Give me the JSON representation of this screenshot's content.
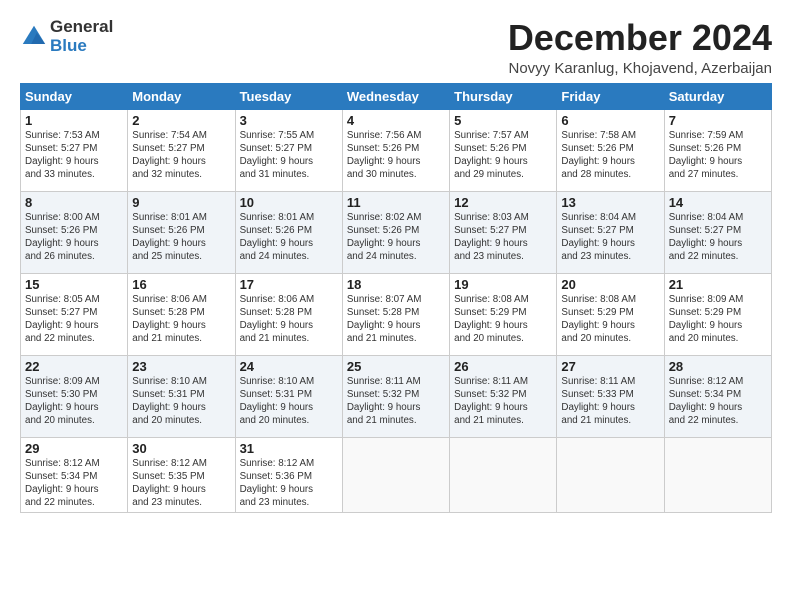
{
  "logo": {
    "general": "General",
    "blue": "Blue"
  },
  "title": "December 2024",
  "location": "Novyy Karanlug, Khojavend, Azerbaijan",
  "weekdays": [
    "Sunday",
    "Monday",
    "Tuesday",
    "Wednesday",
    "Thursday",
    "Friday",
    "Saturday"
  ],
  "weeks": [
    [
      {
        "day": "1",
        "info": "Sunrise: 7:53 AM\nSunset: 5:27 PM\nDaylight: 9 hours\nand 33 minutes."
      },
      {
        "day": "2",
        "info": "Sunrise: 7:54 AM\nSunset: 5:27 PM\nDaylight: 9 hours\nand 32 minutes."
      },
      {
        "day": "3",
        "info": "Sunrise: 7:55 AM\nSunset: 5:27 PM\nDaylight: 9 hours\nand 31 minutes."
      },
      {
        "day": "4",
        "info": "Sunrise: 7:56 AM\nSunset: 5:26 PM\nDaylight: 9 hours\nand 30 minutes."
      },
      {
        "day": "5",
        "info": "Sunrise: 7:57 AM\nSunset: 5:26 PM\nDaylight: 9 hours\nand 29 minutes."
      },
      {
        "day": "6",
        "info": "Sunrise: 7:58 AM\nSunset: 5:26 PM\nDaylight: 9 hours\nand 28 minutes."
      },
      {
        "day": "7",
        "info": "Sunrise: 7:59 AM\nSunset: 5:26 PM\nDaylight: 9 hours\nand 27 minutes."
      }
    ],
    [
      {
        "day": "8",
        "info": "Sunrise: 8:00 AM\nSunset: 5:26 PM\nDaylight: 9 hours\nand 26 minutes."
      },
      {
        "day": "9",
        "info": "Sunrise: 8:01 AM\nSunset: 5:26 PM\nDaylight: 9 hours\nand 25 minutes."
      },
      {
        "day": "10",
        "info": "Sunrise: 8:01 AM\nSunset: 5:26 PM\nDaylight: 9 hours\nand 24 minutes."
      },
      {
        "day": "11",
        "info": "Sunrise: 8:02 AM\nSunset: 5:26 PM\nDaylight: 9 hours\nand 24 minutes."
      },
      {
        "day": "12",
        "info": "Sunrise: 8:03 AM\nSunset: 5:27 PM\nDaylight: 9 hours\nand 23 minutes."
      },
      {
        "day": "13",
        "info": "Sunrise: 8:04 AM\nSunset: 5:27 PM\nDaylight: 9 hours\nand 23 minutes."
      },
      {
        "day": "14",
        "info": "Sunrise: 8:04 AM\nSunset: 5:27 PM\nDaylight: 9 hours\nand 22 minutes."
      }
    ],
    [
      {
        "day": "15",
        "info": "Sunrise: 8:05 AM\nSunset: 5:27 PM\nDaylight: 9 hours\nand 22 minutes."
      },
      {
        "day": "16",
        "info": "Sunrise: 8:06 AM\nSunset: 5:28 PM\nDaylight: 9 hours\nand 21 minutes."
      },
      {
        "day": "17",
        "info": "Sunrise: 8:06 AM\nSunset: 5:28 PM\nDaylight: 9 hours\nand 21 minutes."
      },
      {
        "day": "18",
        "info": "Sunrise: 8:07 AM\nSunset: 5:28 PM\nDaylight: 9 hours\nand 21 minutes."
      },
      {
        "day": "19",
        "info": "Sunrise: 8:08 AM\nSunset: 5:29 PM\nDaylight: 9 hours\nand 20 minutes."
      },
      {
        "day": "20",
        "info": "Sunrise: 8:08 AM\nSunset: 5:29 PM\nDaylight: 9 hours\nand 20 minutes."
      },
      {
        "day": "21",
        "info": "Sunrise: 8:09 AM\nSunset: 5:29 PM\nDaylight: 9 hours\nand 20 minutes."
      }
    ],
    [
      {
        "day": "22",
        "info": "Sunrise: 8:09 AM\nSunset: 5:30 PM\nDaylight: 9 hours\nand 20 minutes."
      },
      {
        "day": "23",
        "info": "Sunrise: 8:10 AM\nSunset: 5:31 PM\nDaylight: 9 hours\nand 20 minutes."
      },
      {
        "day": "24",
        "info": "Sunrise: 8:10 AM\nSunset: 5:31 PM\nDaylight: 9 hours\nand 20 minutes."
      },
      {
        "day": "25",
        "info": "Sunrise: 8:11 AM\nSunset: 5:32 PM\nDaylight: 9 hours\nand 21 minutes."
      },
      {
        "day": "26",
        "info": "Sunrise: 8:11 AM\nSunset: 5:32 PM\nDaylight: 9 hours\nand 21 minutes."
      },
      {
        "day": "27",
        "info": "Sunrise: 8:11 AM\nSunset: 5:33 PM\nDaylight: 9 hours\nand 21 minutes."
      },
      {
        "day": "28",
        "info": "Sunrise: 8:12 AM\nSunset: 5:34 PM\nDaylight: 9 hours\nand 22 minutes."
      }
    ],
    [
      {
        "day": "29",
        "info": "Sunrise: 8:12 AM\nSunset: 5:34 PM\nDaylight: 9 hours\nand 22 minutes."
      },
      {
        "day": "30",
        "info": "Sunrise: 8:12 AM\nSunset: 5:35 PM\nDaylight: 9 hours\nand 23 minutes."
      },
      {
        "day": "31",
        "info": "Sunrise: 8:12 AM\nSunset: 5:36 PM\nDaylight: 9 hours\nand 23 minutes."
      },
      null,
      null,
      null,
      null
    ]
  ]
}
